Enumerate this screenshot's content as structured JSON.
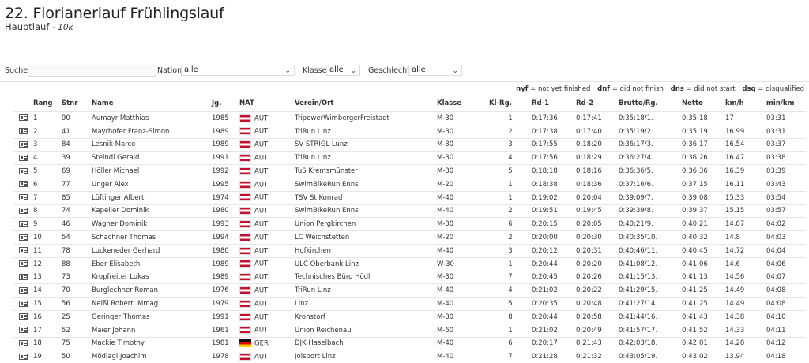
{
  "event": {
    "title": "22. Florianerlauf Frühlingslauf",
    "race": "Hauptlauf",
    "distance": "10k"
  },
  "filters": {
    "search_label": "Suche",
    "search_value": "",
    "nation_label": "Nation",
    "nation_value": "alle",
    "klasse_label": "Klasse",
    "klasse_value": "alle",
    "geschlecht_label": "Geschlecht",
    "geschlecht_value": "alle"
  },
  "legend": {
    "nyf_key": "nyf",
    "nyf_text": "= not yet finished",
    "dnf_key": "dnf",
    "dnf_text": "= did not finish",
    "dns_key": "dns",
    "dns_text": "= did not start",
    "dsq_key": "dsq",
    "dsq_text": "= disqualified"
  },
  "table": {
    "headers": {
      "rang": "Rang",
      "stnr": "Stnr",
      "name": "Name",
      "jg": "Jg.",
      "nat": "NAT",
      "verein": "Verein/Ort",
      "klasse": "Klasse",
      "klrg": "Kl-Rg.",
      "rd1": "Rd-1",
      "rd2": "Rd-2",
      "brutto": "Brutto/Rg.",
      "netto": "Netto",
      "kmh": "km/h",
      "minkm": "min/km"
    },
    "rows": [
      {
        "rang": "1",
        "stnr": "90",
        "name": "Aumayr Matthias",
        "jg": "1985",
        "nat": "AUT",
        "verein": "TripowerWimbergerFreistadt",
        "klasse": "M-30",
        "klrg": "1",
        "rd1": "0:17:36",
        "rd2": "0:17:41",
        "brutto": "0:35:18/1.",
        "netto": "0:35:18",
        "kmh": "17",
        "minkm": "03:31"
      },
      {
        "rang": "2",
        "stnr": "41",
        "name": "Mayrhofer Franz-Simon",
        "jg": "1989",
        "nat": "AUT",
        "verein": "TriRun Linz",
        "klasse": "M-30",
        "klrg": "2",
        "rd1": "0:17:38",
        "rd2": "0:17:40",
        "brutto": "0:35:19/2.",
        "netto": "0:35:19",
        "kmh": "16.99",
        "minkm": "03:31"
      },
      {
        "rang": "3",
        "stnr": "84",
        "name": "Lesnik Marco",
        "jg": "1989",
        "nat": "AUT",
        "verein": "SV STRIGL Lunz",
        "klasse": "M-30",
        "klrg": "3",
        "rd1": "0:17:55",
        "rd2": "0:18:20",
        "brutto": "0:36:17/3.",
        "netto": "0:36:17",
        "kmh": "16.54",
        "minkm": "03:37"
      },
      {
        "rang": "4",
        "stnr": "39",
        "name": "Steindl Gerald",
        "jg": "1991",
        "nat": "AUT",
        "verein": "TriRun Linz",
        "klasse": "M-30",
        "klrg": "4",
        "rd1": "0:17:56",
        "rd2": "0:18:29",
        "brutto": "0:36:27/4.",
        "netto": "0:36:26",
        "kmh": "16.47",
        "minkm": "03:38"
      },
      {
        "rang": "5",
        "stnr": "69",
        "name": "Höller Michael",
        "jg": "1992",
        "nat": "AUT",
        "verein": "TuS Kremsmünster",
        "klasse": "M-30",
        "klrg": "5",
        "rd1": "0:18:18",
        "rd2": "0:18:16",
        "brutto": "0:36:36/5.",
        "netto": "0:36:36",
        "kmh": "16.39",
        "minkm": "03:39"
      },
      {
        "rang": "6",
        "stnr": "77",
        "name": "Unger Alex",
        "jg": "1995",
        "nat": "AUT",
        "verein": "SwimBikeRun Enns",
        "klasse": "M-20",
        "klrg": "1",
        "rd1": "0:18:38",
        "rd2": "0:18:36",
        "brutto": "0:37:16/6.",
        "netto": "0:37:15",
        "kmh": "16.11",
        "minkm": "03:43"
      },
      {
        "rang": "7",
        "stnr": "85",
        "name": "Lüftinger Albert",
        "jg": "1974",
        "nat": "AUT",
        "verein": "TSV St Konrad",
        "klasse": "M-40",
        "klrg": "1",
        "rd1": "0:19:02",
        "rd2": "0:20:04",
        "brutto": "0:39:09/7.",
        "netto": "0:39:08",
        "kmh": "15.33",
        "minkm": "03:54"
      },
      {
        "rang": "8",
        "stnr": "74",
        "name": "Kapeller Dominik",
        "jg": "1980",
        "nat": "AUT",
        "verein": "SwimBikeRun Enns",
        "klasse": "M-40",
        "klrg": "2",
        "rd1": "0:19:51",
        "rd2": "0:19:45",
        "brutto": "0:39:39/8.",
        "netto": "0:39:37",
        "kmh": "15.15",
        "minkm": "03:57"
      },
      {
        "rang": "9",
        "stnr": "46",
        "name": "Wagner Dominik",
        "jg": "1993",
        "nat": "AUT",
        "verein": "Union Pergkirchen",
        "klasse": "M-30",
        "klrg": "6",
        "rd1": "0:20:15",
        "rd2": "0:20:05",
        "brutto": "0:40:21/9.",
        "netto": "0:40:21",
        "kmh": "14.87",
        "minkm": "04:02"
      },
      {
        "rang": "10",
        "stnr": "54",
        "name": "Schachner Thomas",
        "jg": "1994",
        "nat": "AUT",
        "verein": "LC Weichstetten",
        "klasse": "M-20",
        "klrg": "2",
        "rd1": "0:20:00",
        "rd2": "0:20:30",
        "brutto": "0:40:35/10.",
        "netto": "0:40:32",
        "kmh": "14.8",
        "minkm": "04:03"
      },
      {
        "rang": "11",
        "stnr": "78",
        "name": "Luckeneder Gerhard",
        "jg": "1980",
        "nat": "AUT",
        "verein": "Hofkirchen",
        "klasse": "M-40",
        "klrg": "3",
        "rd1": "0:20:12",
        "rd2": "0:20:31",
        "brutto": "0:40:46/11.",
        "netto": "0:40:45",
        "kmh": "14.72",
        "minkm": "04:04"
      },
      {
        "rang": "12",
        "stnr": "88",
        "name": "Eber Elisabeth",
        "jg": "1989",
        "nat": "AUT",
        "verein": "ULC Oberbank Linz",
        "klasse": "W-30",
        "klrg": "1",
        "rd1": "0:20:44",
        "rd2": "0:20:20",
        "brutto": "0:41:08/12.",
        "netto": "0:41:06",
        "kmh": "14.6",
        "minkm": "04:06"
      },
      {
        "rang": "13",
        "stnr": "73",
        "name": "Kropfreiter Lukas",
        "jg": "1989",
        "nat": "AUT",
        "verein": "Technisches Büro Hödl",
        "klasse": "M-30",
        "klrg": "7",
        "rd1": "0:20:45",
        "rd2": "0:20:26",
        "brutto": "0:41:15/13.",
        "netto": "0:41:13",
        "kmh": "14.56",
        "minkm": "04:07"
      },
      {
        "rang": "14",
        "stnr": "70",
        "name": "Burglechner Roman",
        "jg": "1976",
        "nat": "AUT",
        "verein": "TriRun Linz",
        "klasse": "M-40",
        "klrg": "4",
        "rd1": "0:21:02",
        "rd2": "0:20:22",
        "brutto": "0:41:29/15.",
        "netto": "0:41:25",
        "kmh": "14.49",
        "minkm": "04:08"
      },
      {
        "rang": "15",
        "stnr": "56",
        "name": "Neißl Robert, Mmag.",
        "jg": "1979",
        "nat": "AUT",
        "verein": "Linz",
        "klasse": "M-40",
        "klrg": "5",
        "rd1": "0:20:35",
        "rd2": "0:20:48",
        "brutto": "0:41:27/14.",
        "netto": "0:41:25",
        "kmh": "14.49",
        "minkm": "04:08"
      },
      {
        "rang": "16",
        "stnr": "25",
        "name": "Geringer Thomas",
        "jg": "1991",
        "nat": "AUT",
        "verein": "Kronstorf",
        "klasse": "M-30",
        "klrg": "8",
        "rd1": "0:20:44",
        "rd2": "0:20:58",
        "brutto": "0:41:44/16.",
        "netto": "0:41:43",
        "kmh": "14.38",
        "minkm": "04:10"
      },
      {
        "rang": "17",
        "stnr": "52",
        "name": "Maier Johann",
        "jg": "1961",
        "nat": "AUT",
        "verein": "Union Reichenau",
        "klasse": "M-60",
        "klrg": "1",
        "rd1": "0:21:02",
        "rd2": "0:20:49",
        "brutto": "0:41:57/17.",
        "netto": "0:41:52",
        "kmh": "14.33",
        "minkm": "04:11"
      },
      {
        "rang": "18",
        "stnr": "75",
        "name": "Mackie Timothy",
        "jg": "1981",
        "nat": "GER",
        "verein": "DJK Haselbach",
        "klasse": "M-40",
        "klrg": "6",
        "rd1": "0:20:17",
        "rd2": "0:21:43",
        "brutto": "0:42:03/18.",
        "netto": "0:42:01",
        "kmh": "14.28",
        "minkm": "04:12"
      },
      {
        "rang": "19",
        "stnr": "50",
        "name": "Mödlagl Joachim",
        "jg": "1978",
        "nat": "AUT",
        "verein": "Jolsport Linz",
        "klasse": "M-40",
        "klrg": "7",
        "rd1": "0:21:28",
        "rd2": "0:21:32",
        "brutto": "0:43:05/19.",
        "netto": "0:43:02",
        "kmh": "13.94",
        "minkm": "04:18"
      }
    ]
  }
}
